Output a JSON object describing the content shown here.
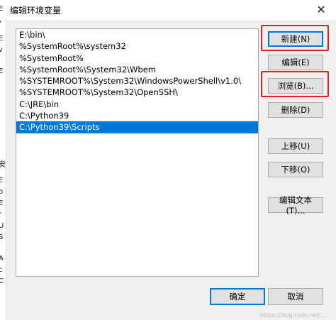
{
  "window": {
    "title": "编辑环境变量",
    "close_glyph": "✕"
  },
  "background_strip": [
    "E",
    "\\",
    "E",
    "v",
    "E",
    "",
    "",
    "",
    "",
    "",
    "",
    "",
    "",
    "",
    "",
    "",
    "",
    "",
    "",
    "",
    "安",
    "E",
    "o",
    "E",
    "r",
    "U",
    "S",
    "A",
    "c",
    "C"
  ],
  "path_list": {
    "items": [
      "E:\\bin\\",
      "%SystemRoot%\\system32",
      "%SystemRoot%",
      "%SystemRoot%\\System32\\Wbem",
      "%SYSTEMROOT%\\System32\\WindowsPowerShell\\v1.0\\",
      "%SYSTEMROOT%\\System32\\OpenSSH\\",
      "C:\\JRE\\bin",
      "C:\\Python39",
      "C:\\Python39\\Scripts"
    ],
    "selected_index": 8
  },
  "buttons": {
    "new": "新建(N)",
    "edit": "编辑(E)",
    "browse": "浏览(B)...",
    "delete": "删除(D)",
    "move_up": "上移(U)",
    "move_down": "下移(O)",
    "edit_text": "编辑文本(T)...",
    "ok": "确定",
    "cancel": "取消"
  },
  "colors": {
    "selection": "#0078d7",
    "highlight_box": "#e02020"
  },
  "watermark": "https://blog.csdn.net/..."
}
